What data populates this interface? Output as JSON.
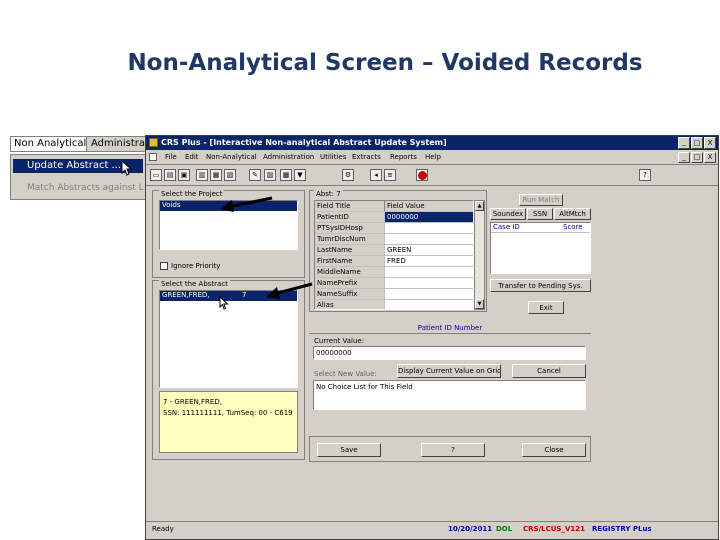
{
  "slide": {
    "title": "Non-Analytical Screen – Voided Records"
  },
  "bg_menu": {
    "tab_active": "Non Analytical",
    "tab_next": "Administrat",
    "item_selected": "Update Abstract ...",
    "item_other": "Match Abstracts against L"
  },
  "window": {
    "title": "CRS Plus - [Interactive Non-analytical Abstract Update System]",
    "menu": [
      "File",
      "Edit",
      "Non-Analytical",
      "Administration",
      "Utilities",
      "Extracts",
      "Reports",
      "Help"
    ],
    "title_buttons": [
      "_",
      "□",
      "X"
    ],
    "child_buttons": [
      "_",
      "□",
      "X"
    ]
  },
  "project": {
    "label": "Select the Project",
    "selected": "Voids",
    "ignore_priority": "Ignore Priority"
  },
  "abstract": {
    "label": "Select the Abstract",
    "selected_name": "GREEN,FRED,",
    "selected_num": "7"
  },
  "info": {
    "line1": "7 - GREEN,FRED,",
    "line2": "SSN: 111111111, TumSeq: 00 - C619"
  },
  "abst_grid": {
    "label": "Abst: 7",
    "col1": "Field Title",
    "col2": "Field Value",
    "rows": [
      {
        "title": "PatientID",
        "value": "0000000"
      },
      {
        "title": "PTSysIDHosp",
        "value": ""
      },
      {
        "title": "TumrDiscNum",
        "value": ""
      },
      {
        "title": "LastName",
        "value": "GREEN"
      },
      {
        "title": "FirstName",
        "value": "FRED"
      },
      {
        "title": "MiddleName",
        "value": ""
      },
      {
        "title": "NamePrefix",
        "value": ""
      },
      {
        "title": "NameSuffix",
        "value": ""
      },
      {
        "title": "Alias",
        "value": ""
      }
    ]
  },
  "run_match": {
    "run_label": "Run Match",
    "tabs": [
      "Soundex",
      "SSN",
      "AltMtch"
    ],
    "col1": "Case ID",
    "col2": "Score",
    "transfer": "Transfer to Pending Sys.",
    "exit": "Exit"
  },
  "field_editor": {
    "header": "Patient ID Number",
    "current_label": "Current Value:",
    "current_value": "00000000",
    "display_btn": "Display Current Value on Grid",
    "cancel_btn": "Cancel",
    "new_label": "Select New Value:",
    "new_value": "No Choice List for This Field"
  },
  "bottom_buttons": {
    "save": "Save",
    "help": "?",
    "close": "Close"
  },
  "status": {
    "ready": "Ready",
    "date": "10/20/2011",
    "user": "DOL",
    "version": "CRS/LCUS_V121",
    "registry": "REGISTRY PLus"
  },
  "colors": {
    "title_blue": "#1f3864",
    "selection": "#0a246a",
    "titlebar": "#0a246a",
    "status_green": "#008000",
    "status_red": "#c00000"
  }
}
